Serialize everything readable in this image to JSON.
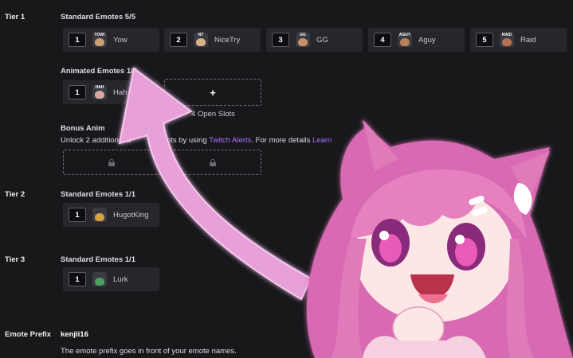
{
  "tier1": {
    "label": "Tier 1",
    "standard_title": "Standard Emotes 5/5",
    "standard_slots": [
      {
        "num": "1",
        "name": "Yow",
        "tag": "YOW!",
        "color": "#caa070"
      },
      {
        "num": "2",
        "name": "NiceTry",
        "tag": "NT",
        "color": "#d9b08a"
      },
      {
        "num": "3",
        "name": "GG",
        "tag": "GG",
        "color": "#c89068"
      },
      {
        "num": "4",
        "name": "Aguy",
        "tag": "AGUY",
        "color": "#b88058"
      },
      {
        "num": "5",
        "name": "Raid",
        "tag": "RAID",
        "color": "#b87050"
      }
    ],
    "animated_title": "Animated Emotes 1/5",
    "animated_slots": [
      {
        "num": "1",
        "name": "Hah",
        "tag": "HAH",
        "color": "#d9a8a0"
      }
    ],
    "add_button": "+",
    "open_slots_text": "4 Open Slots",
    "bonus_title": "Bonus Anim",
    "bonus_desc_start": "Unlock 2 additional a",
    "bonus_desc_mid": "ote slots by using ",
    "bonus_link": "Twitch Alerts",
    "bonus_desc_end": ". For more details ",
    "bonus_learn": "Learn"
  },
  "tier2": {
    "label": "Tier 2",
    "standard_title": "Standard Emotes 1/1",
    "slots": [
      {
        "num": "1",
        "name": "HugotKing",
        "tag": "",
        "color": "#d9a040"
      }
    ]
  },
  "tier3": {
    "label": "Tier 3",
    "standard_title": "Standard Emotes 1/1",
    "slots": [
      {
        "num": "1",
        "name": "Lurk",
        "tag": "",
        "color": "#4aa060"
      }
    ]
  },
  "prefix": {
    "label": "Emote Prefix",
    "value": "kenjii16",
    "description": "The emote prefix goes in front of your emote names."
  },
  "colors": {
    "background": "#18181b",
    "slot": "#26262c",
    "link": "#a970ff",
    "arrow": "#e8a0d8"
  },
  "icons": [
    "lock-icon",
    "plus-icon",
    "arrow-overlay",
    "anime-girl-overlay"
  ]
}
